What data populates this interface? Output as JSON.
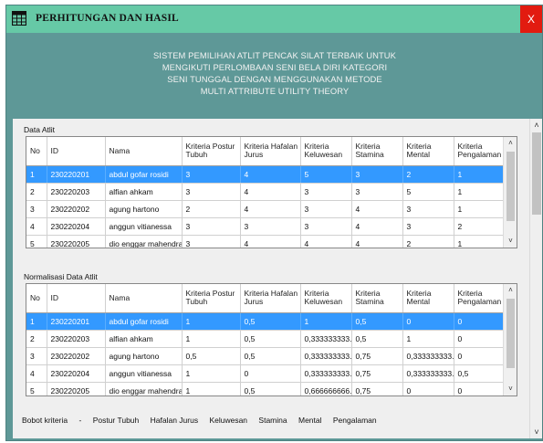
{
  "window": {
    "title": "PERHITUNGAN DAN HASIL",
    "close_label": "X"
  },
  "header": {
    "line1": "SISTEM PEMILIHAN ATLIT PENCAK SILAT TERBAIK UNTUK",
    "line2": "MENGIKUTI PERLOMBAAN SENI BELA DIRI KATEGORI",
    "line3": "SENI TUNGGAL DENGAN MENGGUNAKAN METODE",
    "line4": "MULTI ATTRIBUTE UTILITY THEORY"
  },
  "data_atlit": {
    "label": "Data Atlit",
    "columns": [
      "No",
      "ID",
      "Nama",
      "Kriteria Postur Tubuh",
      "Kriteria Hafalan Jurus",
      "Kriteria Keluwesan",
      "Kriteria Stamina",
      "Kriteria Mental",
      "Kriteria Pengalaman"
    ],
    "rows": [
      [
        "1",
        "230220201",
        "abdul gofar rosidi",
        "3",
        "4",
        "5",
        "3",
        "2",
        "1"
      ],
      [
        "2",
        "230220203",
        "alfian ahkam",
        "3",
        "4",
        "3",
        "3",
        "5",
        "1"
      ],
      [
        "3",
        "230220202",
        "agung hartono",
        "2",
        "4",
        "3",
        "4",
        "3",
        "1"
      ],
      [
        "4",
        "230220204",
        "anggun vitianessa",
        "3",
        "3",
        "3",
        "4",
        "3",
        "2"
      ],
      [
        "5",
        "230220205",
        "dio enggar mahendra",
        "3",
        "4",
        "4",
        "4",
        "2",
        "1"
      ]
    ]
  },
  "normalisasi": {
    "label": "Normalisasi Data Atlit",
    "columns": [
      "No",
      "ID",
      "Nama",
      "Kriteria Postur Tubuh",
      "Kriteria Hafalan Jurus",
      "Kriteria Keluwesan",
      "Kriteria Stamina",
      "Kriteria Mental",
      "Kriteria Pengalaman"
    ],
    "rows": [
      [
        "1",
        "230220201",
        "abdul gofar rosidi",
        "1",
        "0,5",
        "1",
        "0,5",
        "0",
        "0"
      ],
      [
        "2",
        "230220203",
        "alfian ahkam",
        "1",
        "0,5",
        "0,333333333...",
        "0,5",
        "1",
        "0"
      ],
      [
        "3",
        "230220202",
        "agung hartono",
        "0,5",
        "0,5",
        "0,333333333...",
        "0,75",
        "0,333333333...",
        "0"
      ],
      [
        "4",
        "230220204",
        "anggun vitianessa",
        "1",
        "0",
        "0,333333333...",
        "0,75",
        "0,333333333...",
        "0,5"
      ],
      [
        "5",
        "230220205",
        "dio enggar mahendra",
        "1",
        "0,5",
        "0,666666666...",
        "0,75",
        "0",
        "0"
      ]
    ]
  },
  "bobot": {
    "label": "Bobot kriteria",
    "separator": "-",
    "items": [
      "Postur Tubuh",
      "Hafalan Jurus",
      "Keluwesan",
      "Stamina",
      "Mental",
      "Pengalaman"
    ]
  },
  "scroll": {
    "up": "˄",
    "down": "˅"
  },
  "colors": {
    "titlebar": "#66c9a6",
    "window_bg": "#5e9897",
    "close": "#e21b10",
    "selection": "#3399ff"
  }
}
